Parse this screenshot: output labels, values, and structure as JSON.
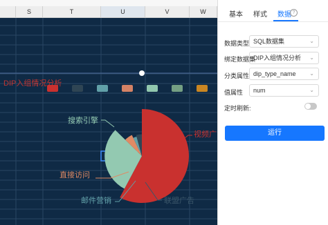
{
  "sheet": {
    "columns": [
      "S",
      "T",
      "U",
      "V",
      "W"
    ],
    "selected_column": "U"
  },
  "chart": {
    "title": "DIP入组情况分析",
    "labels": [
      "视频广",
      "搜索引擎",
      "直接访问",
      "邮件营销",
      "联盟广告"
    ],
    "colors": {
      "视频广告": "#c9312f",
      "搜索引擎": "#93c9b1",
      "直接访问": "#e08a64",
      "邮件营销": "#61a0a8",
      "联盟广告": "#2f4554",
      "title": "#c23531"
    }
  },
  "chart_data": {
    "type": "pie",
    "categories": [
      "视频广告",
      "搜索引擎",
      "直接访问",
      "邮件营销",
      "联盟广告"
    ],
    "values": [
      41,
      21,
      4,
      2,
      3
    ]
  },
  "panel": {
    "tabs": [
      {
        "label": "基本",
        "active": false
      },
      {
        "label": "样式",
        "active": false
      },
      {
        "label": "数据",
        "active": true
      }
    ],
    "help_icon": "?",
    "fields": {
      "data_type_label": "数据类型",
      "data_type_value": "SQL数据集",
      "dataset_label": "绑定数据集",
      "dataset_value": "DIP入组情况分析",
      "category_label": "分类属性",
      "category_value": "dip_type_name",
      "value_label": "值属性",
      "value_value": "num",
      "refresh_label": "定时刷新:"
    },
    "run_label": "运行"
  }
}
